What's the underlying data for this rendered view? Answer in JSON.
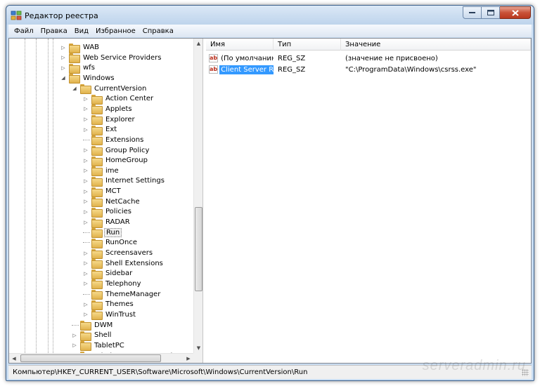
{
  "window": {
    "title": "Редактор реестра"
  },
  "menu": {
    "items": [
      "Файл",
      "Правка",
      "Вид",
      "Избранное",
      "Справка"
    ]
  },
  "tree": {
    "items": [
      {
        "label": "WAB",
        "depth": 0,
        "expander": "collapsed"
      },
      {
        "label": "Web Service Providers",
        "depth": 0,
        "expander": "collapsed"
      },
      {
        "label": "wfs",
        "depth": 0,
        "expander": "collapsed"
      },
      {
        "label": "Windows",
        "depth": 0,
        "expander": "expanded"
      },
      {
        "label": "CurrentVersion",
        "depth": 1,
        "expander": "expanded"
      },
      {
        "label": "Action Center",
        "depth": 2,
        "expander": "collapsed"
      },
      {
        "label": "Applets",
        "depth": 2,
        "expander": "collapsed"
      },
      {
        "label": "Explorer",
        "depth": 2,
        "expander": "collapsed"
      },
      {
        "label": "Ext",
        "depth": 2,
        "expander": "collapsed"
      },
      {
        "label": "Extensions",
        "depth": 2,
        "expander": "none"
      },
      {
        "label": "Group Policy",
        "depth": 2,
        "expander": "collapsed"
      },
      {
        "label": "HomeGroup",
        "depth": 2,
        "expander": "collapsed"
      },
      {
        "label": "ime",
        "depth": 2,
        "expander": "collapsed"
      },
      {
        "label": "Internet Settings",
        "depth": 2,
        "expander": "collapsed"
      },
      {
        "label": "MCT",
        "depth": 2,
        "expander": "collapsed"
      },
      {
        "label": "NetCache",
        "depth": 2,
        "expander": "collapsed"
      },
      {
        "label": "Policies",
        "depth": 2,
        "expander": "collapsed"
      },
      {
        "label": "RADAR",
        "depth": 2,
        "expander": "collapsed"
      },
      {
        "label": "Run",
        "depth": 2,
        "expander": "none",
        "selected": true
      },
      {
        "label": "RunOnce",
        "depth": 2,
        "expander": "none"
      },
      {
        "label": "Screensavers",
        "depth": 2,
        "expander": "collapsed"
      },
      {
        "label": "Shell Extensions",
        "depth": 2,
        "expander": "collapsed"
      },
      {
        "label": "Sidebar",
        "depth": 2,
        "expander": "collapsed"
      },
      {
        "label": "Telephony",
        "depth": 2,
        "expander": "collapsed"
      },
      {
        "label": "ThemeManager",
        "depth": 2,
        "expander": "none"
      },
      {
        "label": "Themes",
        "depth": 2,
        "expander": "collapsed"
      },
      {
        "label": "WinTrust",
        "depth": 2,
        "expander": "collapsed"
      },
      {
        "label": "DWM",
        "depth": 1,
        "expander": "none"
      },
      {
        "label": "Shell",
        "depth": 1,
        "expander": "collapsed"
      },
      {
        "label": "TabletPC",
        "depth": 1,
        "expander": "collapsed"
      },
      {
        "label": "Windows Error Reporting",
        "depth": 1,
        "expander": "collapsed"
      }
    ]
  },
  "list": {
    "columns": {
      "name": "Имя",
      "type": "Тип",
      "data": "Значение"
    },
    "rows": [
      {
        "icon": "ab",
        "name": "(По умолчанию)",
        "type": "REG_SZ",
        "data": "(значение не присвоено)",
        "selected": false
      },
      {
        "icon": "ab",
        "name": "Client Server Ru...",
        "type": "REG_SZ",
        "data": "\"C:\\ProgramData\\Windows\\csrss.exe\"",
        "selected": true
      }
    ]
  },
  "status": {
    "path": "Компьютер\\HKEY_CURRENT_USER\\Software\\Microsoft\\Windows\\CurrentVersion\\Run"
  },
  "watermark": "serveradmin.ru"
}
